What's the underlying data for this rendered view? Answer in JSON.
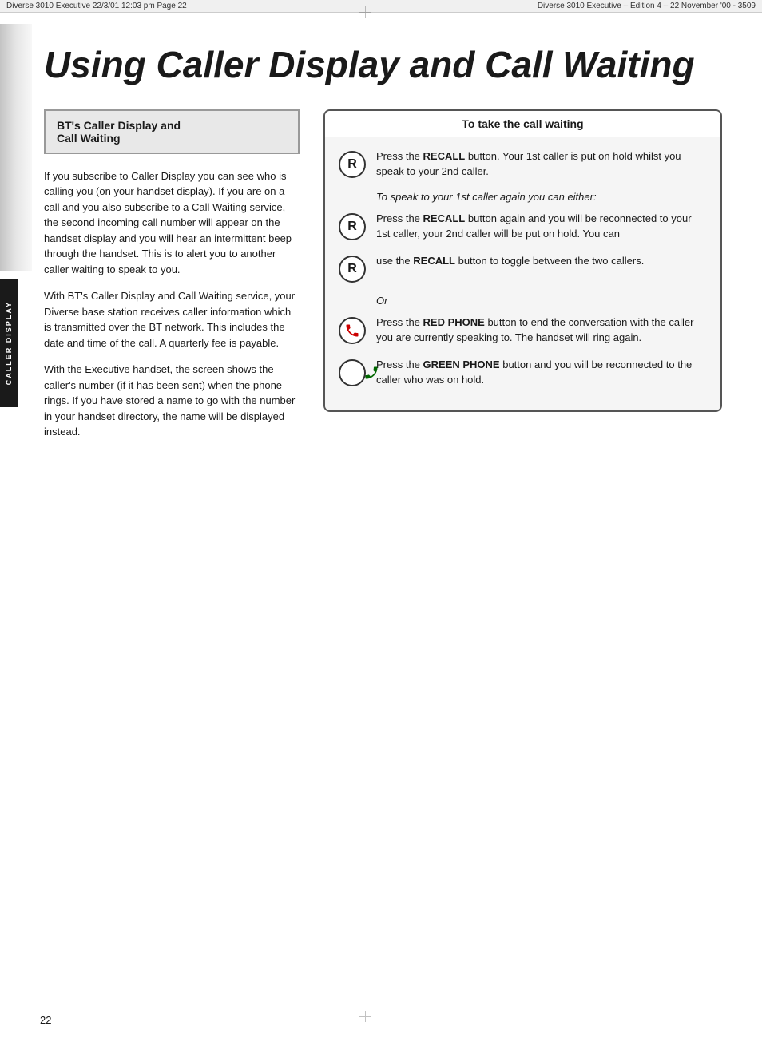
{
  "header": {
    "line1": "Diverse 3010 Executive  22/3/01  12:03 pm  Page 22",
    "line2": "Diverse 3010 Executive – Edition 4 – 22 November '00 - 3509"
  },
  "page_title": "Using Caller Display and Call Waiting",
  "side_label": "CALLER DISPLAY",
  "left_section": {
    "box_title_line1": "BT's Caller Display and",
    "box_title_line2": "Call Waiting",
    "para1": "If you subscribe to Caller Display you can see who is calling you (on your handset display). If you are on a call and you also subscribe to a Call Waiting service, the second incoming call number will appear on the handset display and you will hear an intermittent beep through the handset. This is to alert you to another caller waiting to speak to you.",
    "para2": "With BT's Caller Display and Call Waiting service, your Diverse base station receives caller information which is transmitted over the BT network. This includes the date and time of the call. A quarterly fee is payable.",
    "para3": "With the Executive handset, the screen shows the caller's number (if it has been sent) when the phone rings. If you have stored a name to go with the number in your handset directory, the name will be displayed instead."
  },
  "right_section": {
    "box_title": "To take the call waiting",
    "step1": {
      "icon": "R",
      "text_before": "Press the ",
      "bold": "RECALL",
      "text_after": " button. Your 1st caller is put on hold whilst you speak to your 2nd caller."
    },
    "italic_subhead": "To speak to your 1st caller again you can either:",
    "step2": {
      "icon": "R",
      "text_before": "Press the ",
      "bold": "RECALL",
      "text_after": " button again and you will be reconnected to your 1st caller, your 2nd caller will be put on hold. You can"
    },
    "step3": {
      "icon": "R",
      "text_before": "use the ",
      "bold": "RECALL",
      "text_after": " button to toggle between the two callers."
    },
    "or_text": "Or",
    "step4": {
      "icon": "red-phone",
      "text_before": "Press the ",
      "bold": "RED PHONE",
      "text_after": " button to end the conversation with the caller you are currently speaking to. The handset will ring again."
    },
    "step5": {
      "icon": "green-phone",
      "text_before": "Press the ",
      "bold": "GREEN PHONE",
      "text_after": " button and you will be reconnected to the caller who was on hold."
    }
  },
  "page_number": "22"
}
